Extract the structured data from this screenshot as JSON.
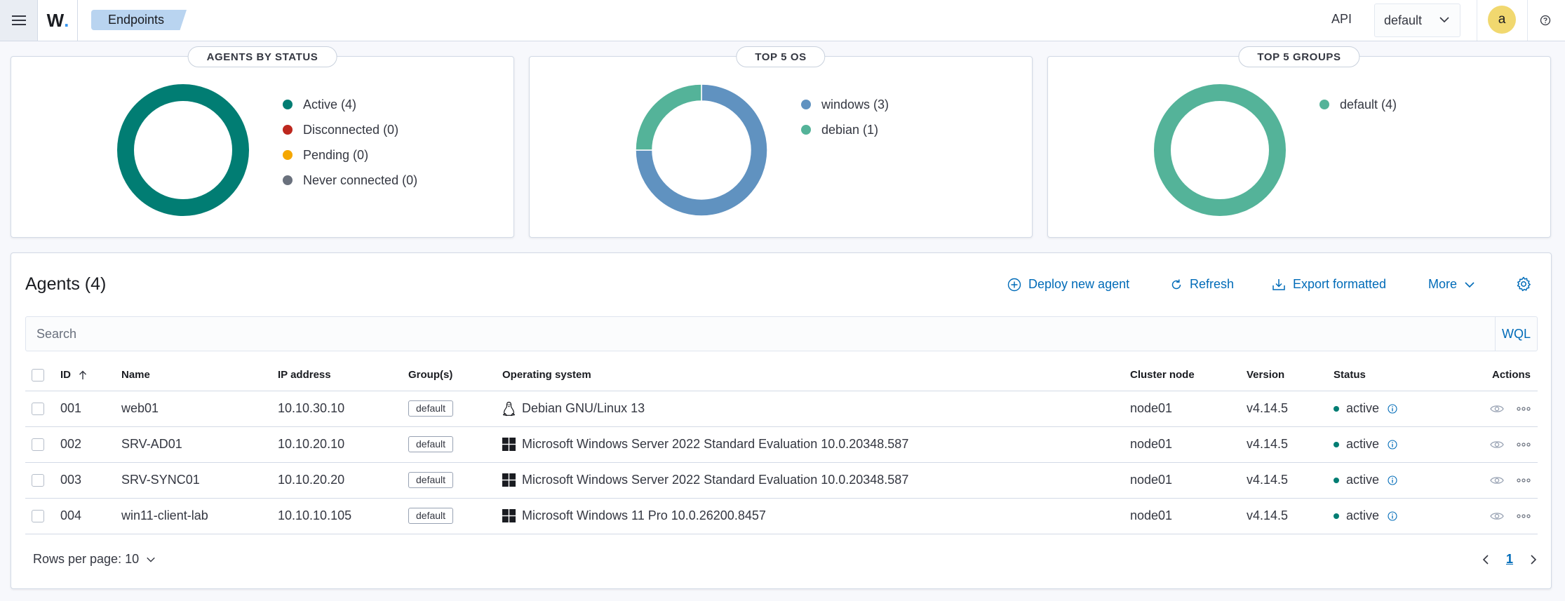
{
  "header": {
    "menu_icon": "hamburger-icon",
    "logo_text": "W",
    "logo_dot": ".",
    "breadcrumb": "Endpoints",
    "api_label": "API",
    "api_selected": "default",
    "avatar_initial": "a"
  },
  "cards": {
    "status": {
      "title": "AGENTS BY STATUS",
      "legend": [
        {
          "label": "Active (4)",
          "color": "#017d73"
        },
        {
          "label": "Disconnected (0)",
          "color": "#bd271e"
        },
        {
          "label": "Pending (0)",
          "color": "#f5a700"
        },
        {
          "label": "Never connected (0)",
          "color": "#6a717d"
        }
      ]
    },
    "os": {
      "title": "TOP 5 OS",
      "legend": [
        {
          "label": "windows (3)",
          "color": "#6092c0"
        },
        {
          "label": "debian (1)",
          "color": "#54b399"
        }
      ]
    },
    "groups": {
      "title": "TOP 5 GROUPS",
      "legend": [
        {
          "label": "default (4)",
          "color": "#54b399"
        }
      ]
    }
  },
  "chart_data": [
    {
      "type": "pie",
      "title": "AGENTS BY STATUS",
      "categories": [
        "Active",
        "Disconnected",
        "Pending",
        "Never connected"
      ],
      "values": [
        4,
        0,
        0,
        0
      ],
      "colors": [
        "#017d73",
        "#bd271e",
        "#f5a700",
        "#6a717d"
      ]
    },
    {
      "type": "pie",
      "title": "TOP 5 OS",
      "categories": [
        "windows",
        "debian"
      ],
      "values": [
        3,
        1
      ],
      "colors": [
        "#6092c0",
        "#54b399"
      ]
    },
    {
      "type": "pie",
      "title": "TOP 5 GROUPS",
      "categories": [
        "default"
      ],
      "values": [
        4
      ],
      "colors": [
        "#54b399"
      ]
    }
  ],
  "agents_panel": {
    "title": "Agents (4)",
    "actions": {
      "deploy": "Deploy new agent",
      "refresh": "Refresh",
      "export": "Export formatted",
      "more": "More"
    },
    "search_placeholder": "Search",
    "wql": "WQL",
    "columns": [
      "ID",
      "Name",
      "IP address",
      "Group(s)",
      "Operating system",
      "Cluster node",
      "Version",
      "Status",
      "Actions"
    ],
    "rows": [
      {
        "id": "001",
        "name": "web01",
        "ip": "10.10.30.10",
        "group": "default",
        "os_icon": "linux-icon",
        "os": "Debian GNU/Linux 13",
        "node": "node01",
        "version": "v4.14.5",
        "status": "active"
      },
      {
        "id": "002",
        "name": "SRV-AD01",
        "ip": "10.10.20.10",
        "group": "default",
        "os_icon": "windows-icon",
        "os": "Microsoft Windows Server 2022 Standard Evaluation 10.0.20348.587",
        "node": "node01",
        "version": "v4.14.5",
        "status": "active"
      },
      {
        "id": "003",
        "name": "SRV-SYNC01",
        "ip": "10.10.20.20",
        "group": "default",
        "os_icon": "windows-icon",
        "os": "Microsoft Windows Server 2022 Standard Evaluation 10.0.20348.587",
        "node": "node01",
        "version": "v4.14.5",
        "status": "active"
      },
      {
        "id": "004",
        "name": "win11-client-lab",
        "ip": "10.10.10.105",
        "group": "default",
        "os_icon": "windows-icon",
        "os": "Microsoft Windows 11 Pro 10.0.26200.8457",
        "node": "node01",
        "version": "v4.14.5",
        "status": "active"
      }
    ],
    "rows_per_page": "Rows per page: 10",
    "current_page": "1"
  }
}
